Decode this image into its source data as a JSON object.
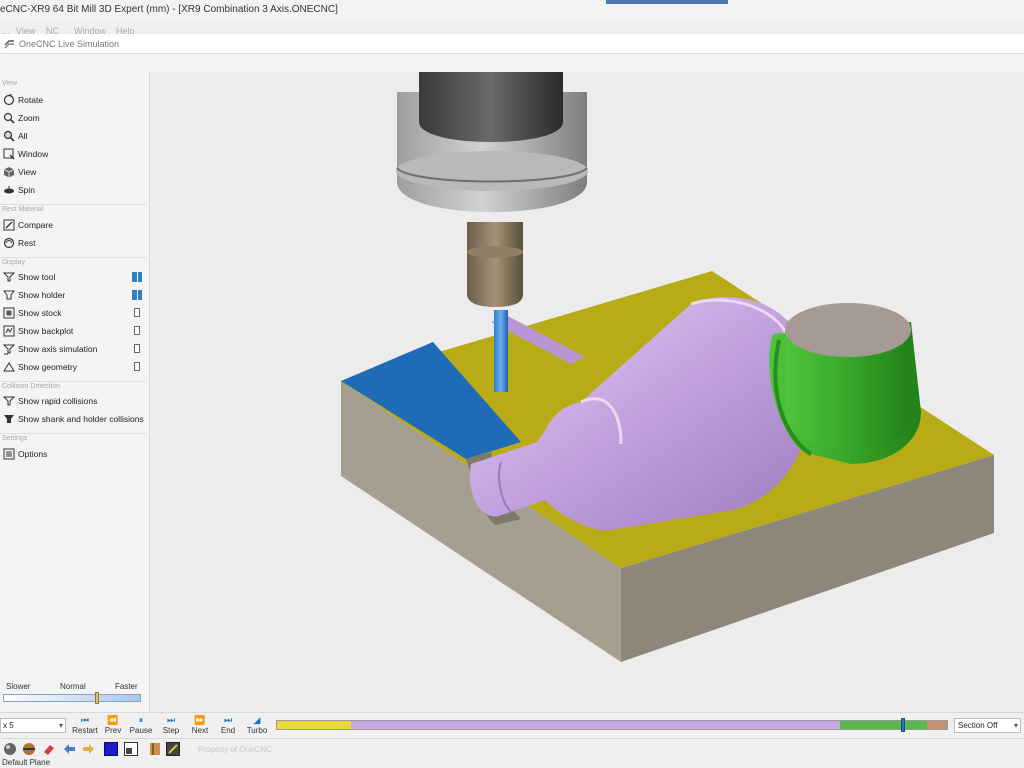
{
  "window": {
    "title": "eCNC-XR9  64 Bit Mill 3D Expert (mm) - [XR9 Combination 3 Axis.ONECNC]",
    "panel_title": "OneCNC Live Simulation"
  },
  "menu": [
    "...",
    "View",
    "NC",
    "Window",
    "Help"
  ],
  "sidebar": {
    "sections": {
      "view": "View",
      "rest": "Rest Material",
      "display": "Display",
      "collision": "Collision Detection",
      "settings": "Settings"
    },
    "view_items": [
      {
        "label": "Rotate",
        "icon": "rotate-icon"
      },
      {
        "label": "Zoom",
        "icon": "zoom-icon"
      },
      {
        "label": "All",
        "icon": "zoom-all-icon"
      },
      {
        "label": "Window",
        "icon": "zoom-window-icon"
      },
      {
        "label": "View",
        "icon": "view-cube-icon"
      },
      {
        "label": "Spin",
        "icon": "spin-icon"
      }
    ],
    "rest_items": [
      {
        "label": "Compare",
        "icon": "compare-icon"
      },
      {
        "label": "Rest",
        "icon": "rest-icon"
      }
    ],
    "display_items": [
      {
        "label": "Show tool",
        "checked": true
      },
      {
        "label": "Show holder",
        "checked": true
      },
      {
        "label": "Show stock",
        "checked": false
      },
      {
        "label": "Show backplot",
        "checked": false
      },
      {
        "label": "Show axis simulation",
        "checked": false
      },
      {
        "label": "Show geometry",
        "checked": false
      }
    ],
    "collision_items": [
      {
        "label": "Show rapid collisions"
      },
      {
        "label": "Show shank and holder collisions"
      }
    ],
    "settings_items": [
      {
        "label": "Options"
      }
    ],
    "speed": {
      "slower": "Slower",
      "normal": "Normal",
      "faster": "Faster",
      "level": 0.68
    }
  },
  "playback": {
    "multiplier": "x 5",
    "buttons": [
      {
        "label": "Restart",
        "glyph": "⏮"
      },
      {
        "label": "Prev",
        "glyph": "⏪"
      },
      {
        "label": "Pause",
        "glyph": "⏸"
      },
      {
        "label": "Step",
        "glyph": "⏭"
      },
      {
        "label": "Next",
        "glyph": "⏩"
      },
      {
        "label": "End",
        "glyph": "⏭"
      },
      {
        "label": "Turbo",
        "glyph": "◢"
      }
    ],
    "progress": 0.93,
    "section": "Section Off"
  },
  "timeline_colors": [
    "#e8d838",
    "#c8a8e0",
    "#58b848",
    "#c89070"
  ],
  "bottom": {
    "watermark": "Property of OneCNC",
    "status": "Default Plane"
  }
}
